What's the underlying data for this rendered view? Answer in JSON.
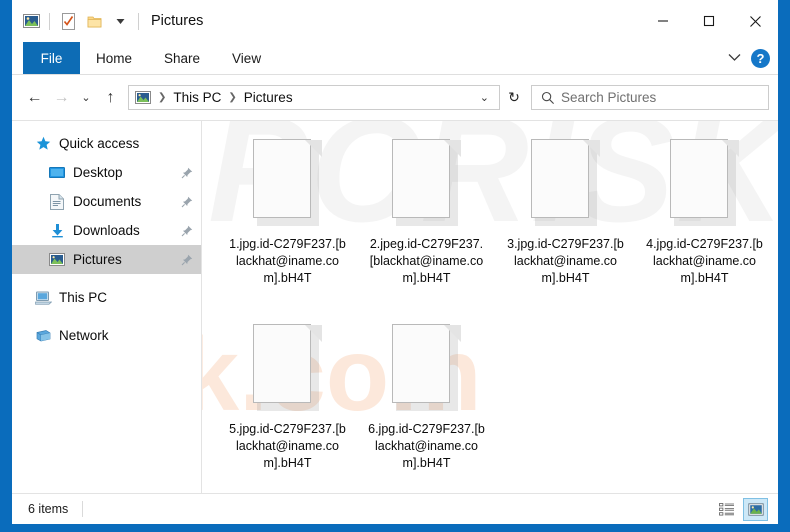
{
  "window": {
    "title": "Pictures",
    "quick_access_icons": [
      "picture-icon",
      "properties-icon",
      "new-folder-icon",
      "customize-dropdown-icon"
    ],
    "controls": {
      "minimize": "─",
      "maximize": "☐",
      "close": "✕"
    }
  },
  "ribbon": {
    "file_tab": "File",
    "tabs": [
      "Home",
      "Share",
      "View"
    ],
    "expand_icon": "chevron-down-icon",
    "help_label": "?"
  },
  "navbar": {
    "back_icon": "←",
    "forward_icon": "→",
    "recent_icon": "⌄",
    "up_icon": "↑",
    "breadcrumb": [
      "This PC",
      "Pictures"
    ],
    "breadcrumb_separator": "❯",
    "dropdown_icon": "⌄",
    "refresh_icon": "↻"
  },
  "search": {
    "placeholder": "Search Pictures",
    "icon": "search-icon"
  },
  "sidebar": {
    "items": [
      {
        "label": "Quick access",
        "icon": "star-icon",
        "level": 0,
        "pinned": false,
        "selected": false
      },
      {
        "label": "Desktop",
        "icon": "desktop-icon",
        "level": 1,
        "pinned": true,
        "selected": false
      },
      {
        "label": "Documents",
        "icon": "documents-icon",
        "level": 1,
        "pinned": true,
        "selected": false
      },
      {
        "label": "Downloads",
        "icon": "downloads-icon",
        "level": 1,
        "pinned": true,
        "selected": false
      },
      {
        "label": "Pictures",
        "icon": "pictures-icon",
        "level": 1,
        "pinned": true,
        "selected": true
      },
      {
        "label": "This PC",
        "icon": "this-pc-icon",
        "level": 0,
        "pinned": false,
        "selected": false
      },
      {
        "label": "Network",
        "icon": "network-icon",
        "level": 0,
        "pinned": false,
        "selected": false
      }
    ]
  },
  "files": [
    {
      "name": "1.jpg.id-C279F237.[blackhat@iname.com].bH4T",
      "icon": "blank-file-icon"
    },
    {
      "name": "2.jpeg.id-C279F237.[blackhat@iname.com].bH4T",
      "icon": "blank-file-icon"
    },
    {
      "name": "3.jpg.id-C279F237.[blackhat@iname.com].bH4T",
      "icon": "blank-file-icon"
    },
    {
      "name": "4.jpg.id-C279F237.[blackhat@iname.com].bH4T",
      "icon": "blank-file-icon"
    },
    {
      "name": "5.jpg.id-C279F237.[blackhat@iname.com].bH4T",
      "icon": "blank-file-icon"
    },
    {
      "name": "6.jpg.id-C279F237.[blackhat@iname.com].bH4T",
      "icon": "blank-file-icon"
    }
  ],
  "statusbar": {
    "item_count": "6 items",
    "details_view_icon": "details-view-icon",
    "large_icons_view_icon": "large-icons-view-icon"
  },
  "watermark": {
    "top_text": "PCRISK",
    "bottom_text": "risk.com"
  },
  "colors": {
    "desktop_blue": "#0a6cbc",
    "file_tab_blue": "#0d6cb5",
    "selection_gray": "#cfcfcf",
    "help_blue": "#1577c8",
    "view_active": "#cde8f7"
  }
}
